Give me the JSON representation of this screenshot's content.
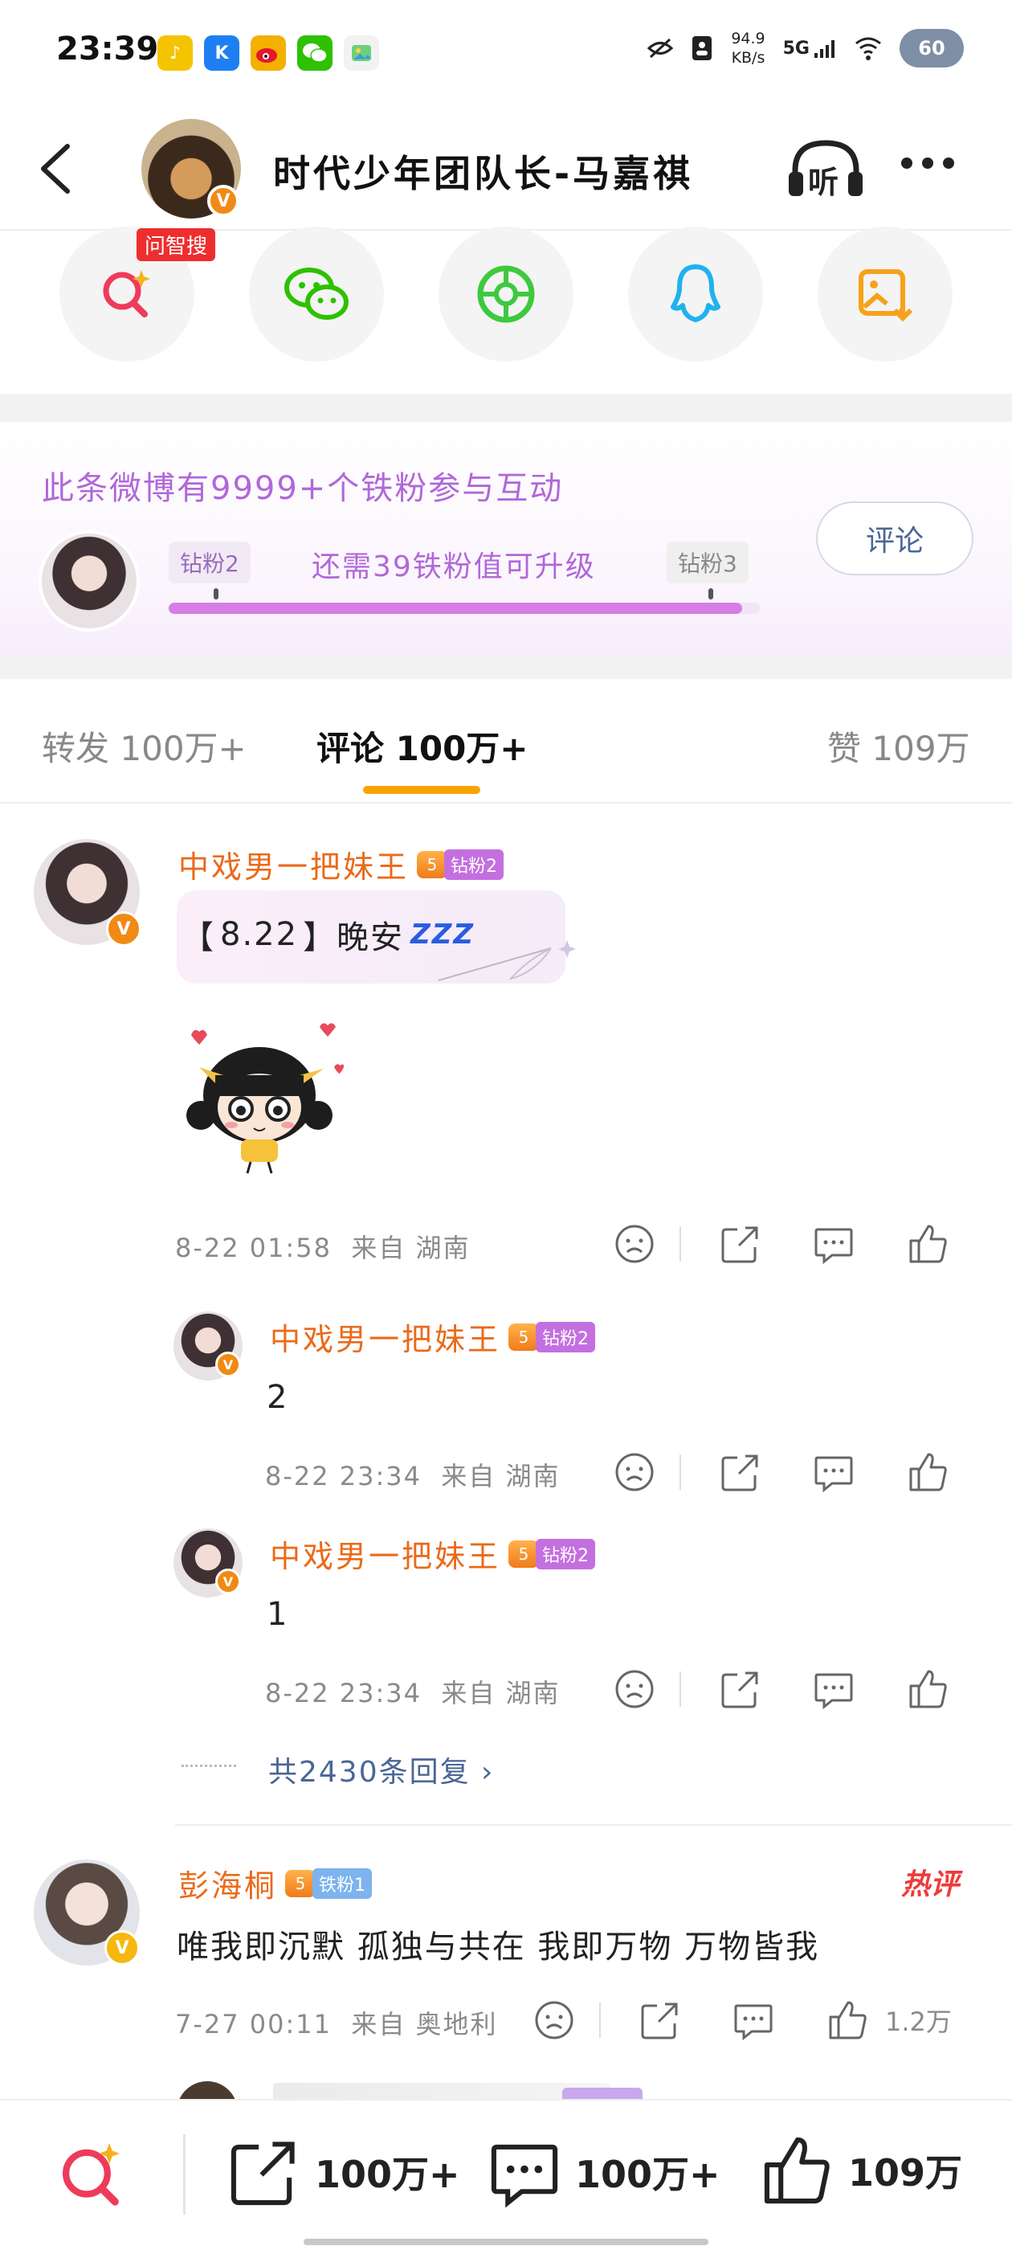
{
  "status_bar": {
    "time": "23:39",
    "network_speed_value": "94.9",
    "network_speed_unit": "KB/s",
    "network_type": "5G",
    "battery": "60",
    "notification_icons": [
      "qq-music-icon",
      "kugou-icon",
      "weibo-icon",
      "wechat-icon",
      "gallery-icon"
    ]
  },
  "header": {
    "title": "时代少年团队长-马嘉祺",
    "avatar_badge": "V",
    "listen_label": "听"
  },
  "share_row": {
    "items": [
      "wenzhisou-search-icon",
      "wechat-icon",
      "moments-icon",
      "qq-icon",
      "save-image-icon"
    ],
    "wenzhisou_tag": "问智搜"
  },
  "fan_card": {
    "title": "此条微博有9999+个铁粉参与互动",
    "current_level": "钻粉2",
    "next_level": "钻粉3",
    "upgrade_text": "还需39铁粉值可升级",
    "progress": 0.97,
    "comment_button": "评论"
  },
  "tabs": [
    {
      "label": "转发",
      "count": "100万+",
      "active": false
    },
    {
      "label": "评论",
      "count": "100万+",
      "active": true
    },
    {
      "label": "赞",
      "count": "109万",
      "active": false
    }
  ],
  "comments": [
    {
      "username": "中戏男一把妹王",
      "crown_level": "5",
      "fan_badge": "钻粉2",
      "text_open": "【",
      "text_date": "8.22",
      "text_close": "】晚安",
      "zzz": "ZZZ",
      "time": "8-22 01:58",
      "location": "来自 湖南",
      "replies": [
        {
          "username": "中戏男一把妹王",
          "crown_level": "5",
          "fan_badge": "钻粉2",
          "text": "2",
          "time": "8-22 23:34",
          "location": "来自 湖南"
        },
        {
          "username": "中戏男一把妹王",
          "crown_level": "5",
          "fan_badge": "钻粉2",
          "text": "1",
          "time": "8-22 23:34",
          "location": "来自 湖南"
        }
      ],
      "more_replies": "共2430条回复 ›"
    },
    {
      "username": "彭海桐",
      "crown_level": "5",
      "fan_badge": "铁粉1",
      "hot_tag": "热评",
      "text": "唯我即沉默 孤独与共在 我即万物 万物皆我",
      "time": "7-27 00:11",
      "location": "来自 奥地利",
      "likes": "1.2万"
    }
  ],
  "bottom_bar": {
    "repost_count": "100万+",
    "comment_count": "100万+",
    "like_count": "109万"
  },
  "colors": {
    "username": "#ea6a1a",
    "fan_purple": "#b068d9",
    "link_blue": "#4a6696",
    "tab_underline": "#f7a300",
    "hot_red": "#ee3b3b"
  }
}
